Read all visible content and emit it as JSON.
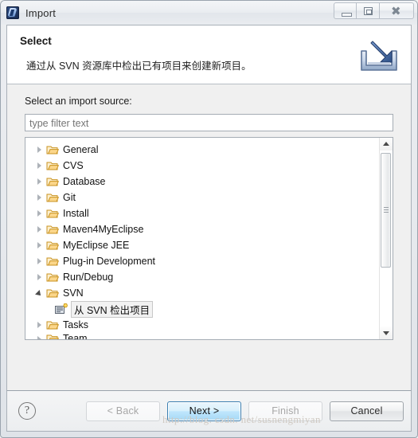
{
  "window": {
    "title": "Import",
    "app_icon": "myeclipse-icon",
    "controls": [
      {
        "name": "minimize-button",
        "glyph": "minimize-icon"
      },
      {
        "name": "maximize-button",
        "glyph": "restore-icon"
      },
      {
        "name": "close-button",
        "glyph": "close-icon"
      }
    ]
  },
  "banner": {
    "title": "Select",
    "description": "通过从 SVN 资源库中检出已有项目来创建新项目。",
    "icon": "import-arrow-icon"
  },
  "content": {
    "source_label": "Select an import source:",
    "filter": {
      "value": "",
      "placeholder": "type filter text"
    },
    "tree": [
      {
        "label": "General",
        "state": "collapsed",
        "icon": "folder-icon",
        "depth": 0
      },
      {
        "label": "CVS",
        "state": "collapsed",
        "icon": "folder-icon",
        "depth": 0
      },
      {
        "label": "Database",
        "state": "collapsed",
        "icon": "folder-icon",
        "depth": 0
      },
      {
        "label": "Git",
        "state": "collapsed",
        "icon": "folder-icon",
        "depth": 0
      },
      {
        "label": "Install",
        "state": "collapsed",
        "icon": "folder-icon",
        "depth": 0
      },
      {
        "label": "Maven4MyEclipse",
        "state": "collapsed",
        "icon": "folder-icon",
        "depth": 0
      },
      {
        "label": "MyEclipse JEE",
        "state": "collapsed",
        "icon": "folder-icon",
        "depth": 0
      },
      {
        "label": "Plug-in Development",
        "state": "collapsed",
        "icon": "folder-icon",
        "depth": 0
      },
      {
        "label": "Run/Debug",
        "state": "collapsed",
        "icon": "folder-icon",
        "depth": 0
      },
      {
        "label": "SVN",
        "state": "expanded",
        "icon": "folder-icon",
        "depth": 0
      },
      {
        "label": "从 SVN 检出项目",
        "state": "selected",
        "icon": "svn-checkout-icon",
        "depth": 1
      },
      {
        "label": "Tasks",
        "state": "collapsed",
        "icon": "folder-icon",
        "depth": 0
      },
      {
        "label": "Team",
        "state": "collapsed",
        "icon": "folder-icon",
        "depth": 0
      }
    ],
    "scrollbar": {
      "up_arrow": "scroll-up-icon",
      "down_arrow": "scroll-down-icon"
    }
  },
  "footer": {
    "help_glyph": "?",
    "back_label": "< Back",
    "next_label": "Next >",
    "finish_label": "Finish",
    "cancel_label": "Cancel",
    "watermark": "http://blog. csdn. net/susnengmiyan"
  },
  "colors": {
    "accent": "#3c7fb1",
    "default_button": "#bee6fd",
    "folder": "#f0b959",
    "banner_bg": "#ffffff"
  }
}
